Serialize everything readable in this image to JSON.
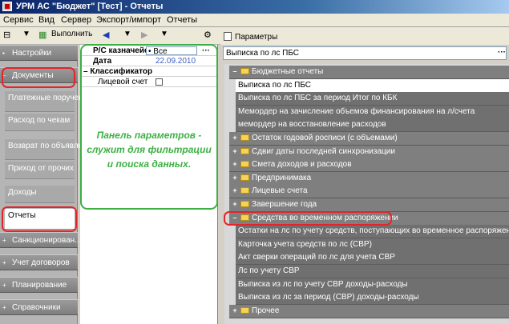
{
  "window": {
    "title": "УРМ АС \"Бюджет\" [Тест] - Отчеты"
  },
  "menu": {
    "items": [
      "Сервис",
      "Вид",
      "Сервер",
      "Экспорт/импорт",
      "Отчеты"
    ]
  },
  "toolbar": {
    "run_label": "Выполнить",
    "params_tab": "Параметры"
  },
  "nav": {
    "sections": [
      "Настройки",
      "Документы",
      "Санкционирован...",
      "Учет договоров",
      "Планирование",
      "Справочники"
    ],
    "doc_items": [
      "Платежные поручения",
      "Расход по чекам",
      "Возврат по объявлениям",
      "Приход от прочих",
      "Доходы",
      "Отчеты"
    ]
  },
  "params": {
    "rows": [
      {
        "label": "Р/С казначейст",
        "value": "• Все"
      },
      {
        "label": "Дата",
        "value": "22.09.2010"
      },
      {
        "label": "Классификатор",
        "value": ""
      },
      {
        "label": "Лицевой счет",
        "value": ""
      }
    ],
    "note": "Панель параметров - служит для фильтрации и поиска данных."
  },
  "reports": {
    "search_value": "Выписка по лс ПБС",
    "tree": [
      {
        "type": "folder",
        "expanded": true,
        "label": "Бюджетные отчеты"
      },
      {
        "type": "leaf",
        "label": "Выписка по лс ПБС",
        "selected": true
      },
      {
        "type": "leaf",
        "label": "Выписка по лс ПБС за период Итог по КБК"
      },
      {
        "type": "leaf",
        "label": "Мемордер на зачисление объемов финансирования на л/счета"
      },
      {
        "type": "leaf",
        "label": "мемордер на восстановление расходов"
      },
      {
        "type": "folder",
        "expanded": false,
        "label": "Остаток годовой росписи (с объемами)"
      },
      {
        "type": "folder",
        "expanded": false,
        "label": "Сдвиг даты последней синхронизации"
      },
      {
        "type": "folder",
        "expanded": false,
        "label": "Смета доходов и расходов"
      },
      {
        "type": "folder",
        "expanded": false,
        "label": "Предпринимака"
      },
      {
        "type": "folder",
        "expanded": false,
        "label": "Лицевые счета"
      },
      {
        "type": "folder",
        "expanded": false,
        "label": "Завершение года"
      },
      {
        "type": "folder",
        "expanded": true,
        "label": "Средства во временном распоряжении"
      },
      {
        "type": "leaf",
        "label": "Остатки на лс по учету средств, поступающих во временное распоряжение"
      },
      {
        "type": "leaf",
        "label": "Карточка учета средств по лс (СВР)"
      },
      {
        "type": "leaf",
        "label": "Акт сверки операций по лс для учета СВР"
      },
      {
        "type": "leaf",
        "label": "Лс по учету СВР"
      },
      {
        "type": "leaf",
        "label": "Выписка из лс по учету СВР доходы-расходы"
      },
      {
        "type": "leaf",
        "label": "Выписка из лс за период (СВР) доходы-расходы"
      },
      {
        "type": "folder",
        "expanded": false,
        "label": "Прочее"
      }
    ]
  }
}
